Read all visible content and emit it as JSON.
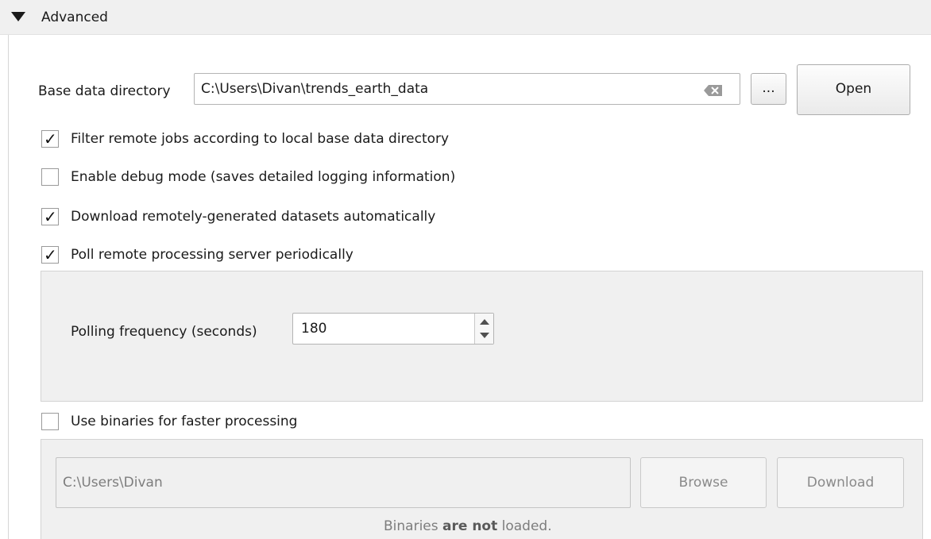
{
  "section": {
    "title": "Advanced",
    "expanded": true
  },
  "base_dir": {
    "label": "Base data directory",
    "value": "C:\\Users\\Divan\\trends_earth_data",
    "browse_label": "...",
    "open_label": "Open"
  },
  "options": [
    {
      "label": "Filter remote jobs according to local base data directory",
      "checked": true
    },
    {
      "label": "Enable debug mode (saves detailed logging information)",
      "checked": false
    },
    {
      "label": "Download remotely-generated datasets automatically",
      "checked": true
    },
    {
      "label": "Poll remote processing server periodically",
      "checked": true
    }
  ],
  "polling": {
    "label": "Polling frequency (seconds)",
    "value": "180"
  },
  "binaries": {
    "checkbox_label": "Use binaries for faster processing",
    "checked": false,
    "path_value": "C:\\Users\\Divan",
    "browse_label": "Browse",
    "download_label": "Download",
    "status_prefix": "Binaries",
    "status_emphasis": "are not",
    "status_suffix": "loaded."
  },
  "icons": {
    "expand": "triangle-down-icon",
    "clear": "clear-text-icon",
    "check": "checkmark-icon",
    "spin": "spin-arrows-icon"
  },
  "colors": {
    "header_bg": "#f0f0f0",
    "panel_bg": "#f0f0f0",
    "border": "#b4b4b4",
    "disabled_text": "#8a8a8a"
  }
}
